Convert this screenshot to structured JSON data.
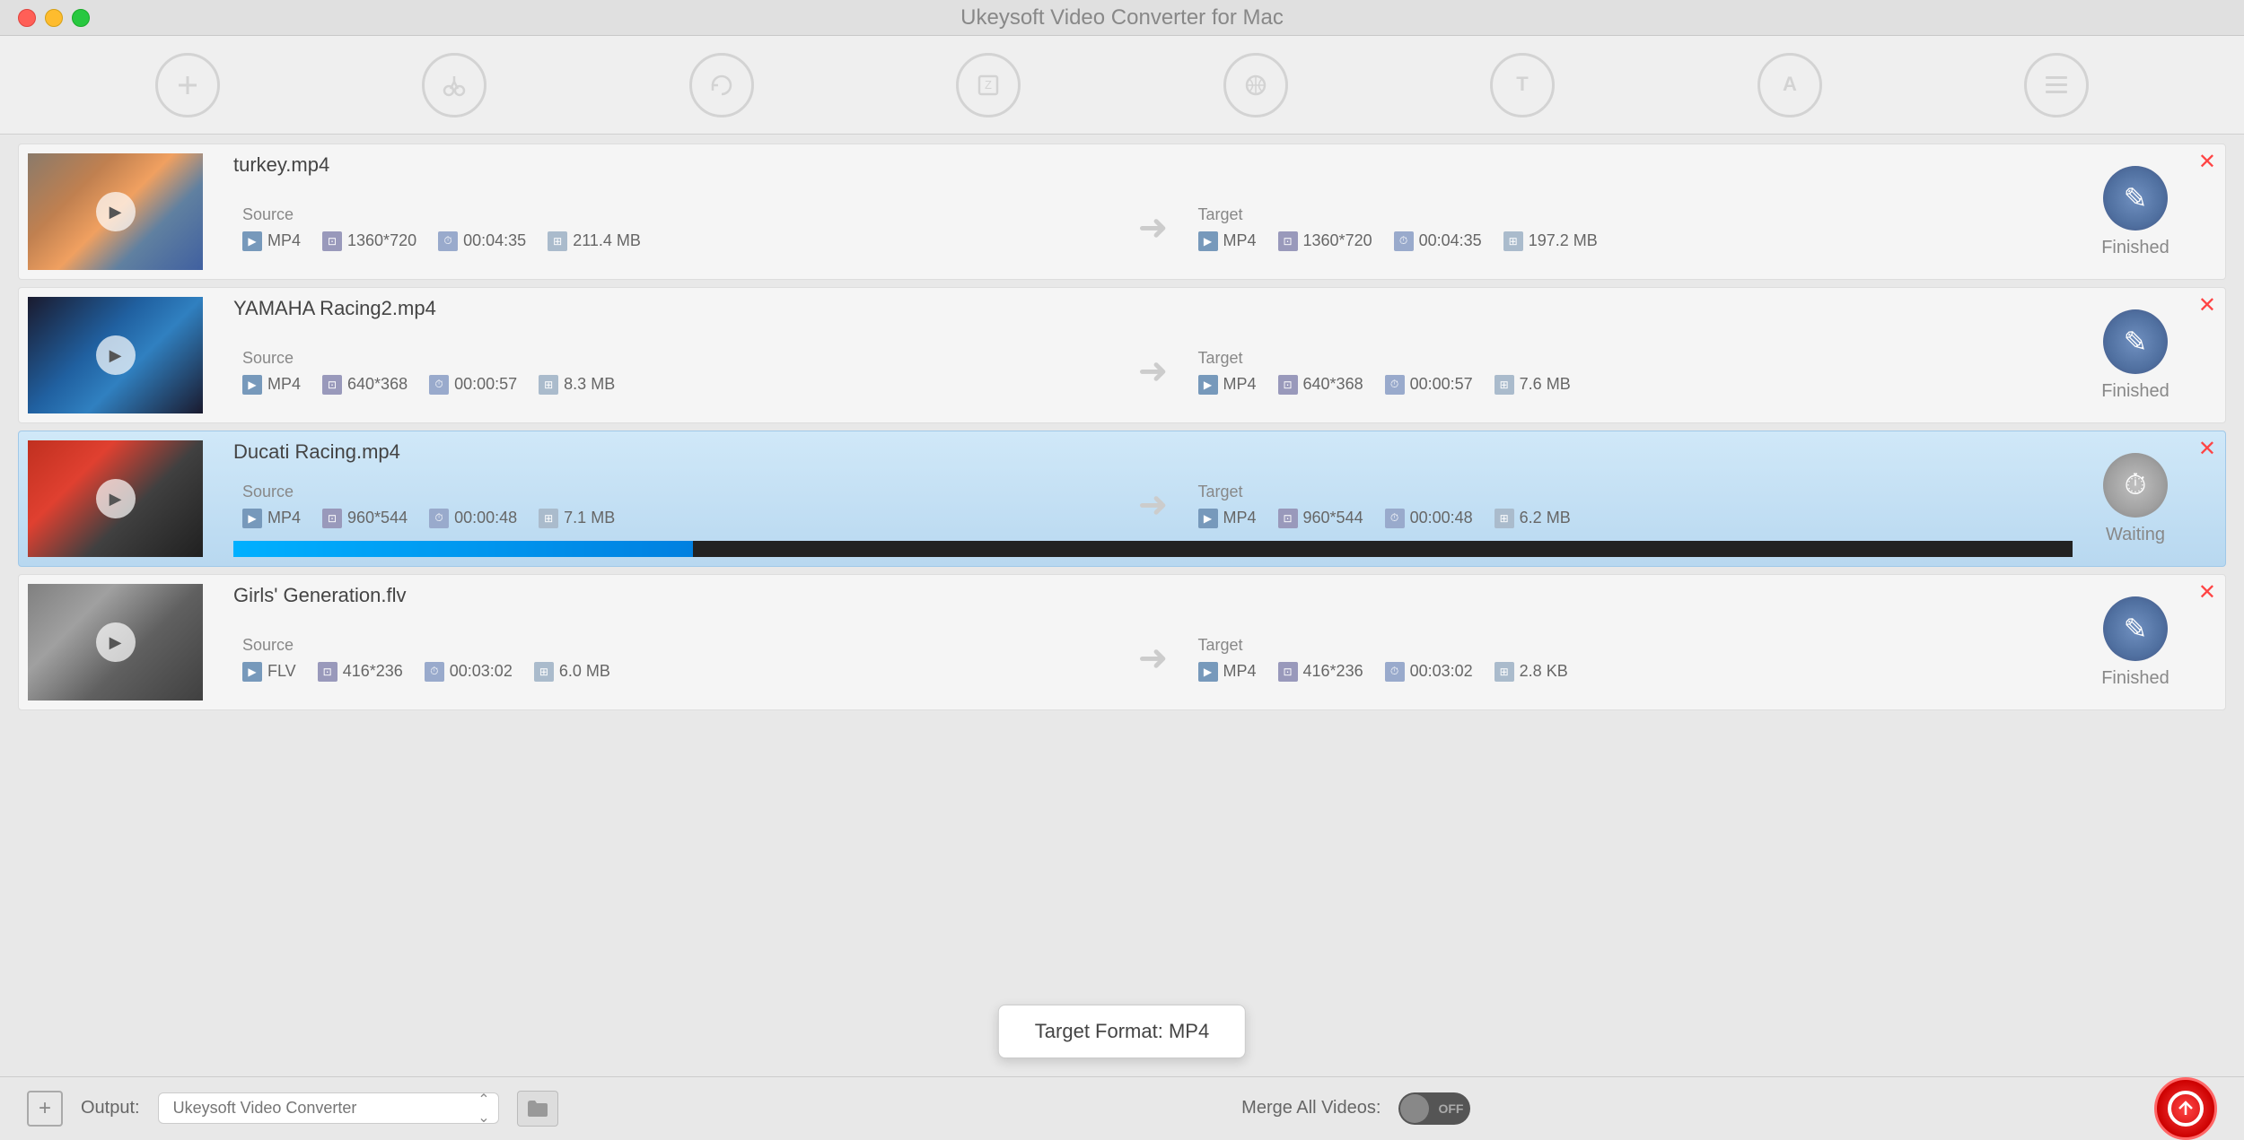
{
  "app": {
    "title": "Ukeysoft Video Converter for Mac"
  },
  "toolbar": {
    "items": [
      {
        "id": "add",
        "icon": "+",
        "label": "Add"
      },
      {
        "id": "edit",
        "icon": "✂",
        "label": "Edit"
      },
      {
        "id": "convert",
        "icon": "↻",
        "label": "Convert"
      },
      {
        "id": "compress",
        "icon": "⊡",
        "label": "Compress"
      },
      {
        "id": "effects",
        "icon": "✦",
        "label": "Effects"
      },
      {
        "id": "subtitle",
        "icon": "T",
        "label": "Subtitle"
      },
      {
        "id": "watermark",
        "icon": "A",
        "label": "Watermark"
      },
      {
        "id": "settings",
        "icon": "⊞",
        "label": "Settings"
      }
    ]
  },
  "videos": [
    {
      "id": "turkey",
      "filename": "turkey.mp4",
      "thumbnail_class": "thumb-turkey",
      "source": {
        "format": "MP4",
        "resolution": "1360*720",
        "duration": "00:04:35",
        "size": "211.4 MB"
      },
      "target": {
        "format": "MP4",
        "resolution": "1360*720",
        "duration": "00:04:35",
        "size": "197.2 MB"
      },
      "status": "Finished",
      "progress": null,
      "active": false
    },
    {
      "id": "yamaha",
      "filename": "YAMAHA Racing2.mp4",
      "thumbnail_class": "thumb-yamaha",
      "source": {
        "format": "MP4",
        "resolution": "640*368",
        "duration": "00:00:57",
        "size": "8.3 MB"
      },
      "target": {
        "format": "MP4",
        "resolution": "640*368",
        "duration": "00:00:57",
        "size": "7.6 MB"
      },
      "status": "Finished",
      "progress": null,
      "active": false
    },
    {
      "id": "ducati",
      "filename": "Ducati Racing.mp4",
      "thumbnail_class": "thumb-ducati",
      "source": {
        "format": "MP4",
        "resolution": "960*544",
        "duration": "00:00:48",
        "size": "7.1 MB"
      },
      "target": {
        "format": "MP4",
        "resolution": "960*544",
        "duration": "00:00:48",
        "size": "6.2 MB"
      },
      "status": "Waiting",
      "progress": 25,
      "active": true
    },
    {
      "id": "girls",
      "filename": "Girls' Generation.flv",
      "thumbnail_class": "thumb-girls",
      "source": {
        "format": "FLV",
        "resolution": "416*236",
        "duration": "00:03:02",
        "size": "6.0 MB"
      },
      "target": {
        "format": "MP4",
        "resolution": "416*236",
        "duration": "00:03:02",
        "size": "2.8 KB"
      },
      "status": "Finished",
      "progress": null,
      "active": false
    }
  ],
  "bottom_bar": {
    "add_label": "+",
    "output_label": "Output:",
    "output_placeholder": "Ukeysoft Video Converter",
    "merge_label": "Merge All Videos:",
    "toggle_state": "OFF"
  },
  "tooltip": {
    "text": "Target Format: MP4"
  }
}
